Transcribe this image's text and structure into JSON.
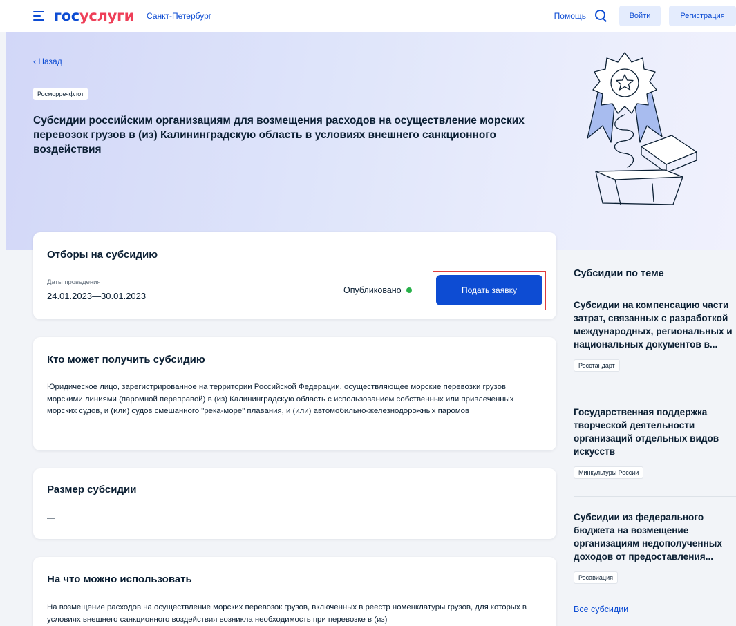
{
  "header": {
    "logo_gos": "гос",
    "logo_uslugi": "услуги",
    "region": "Санкт-Петербург",
    "help": "Помощь",
    "login": "Войти",
    "register": "Регистрация"
  },
  "hero": {
    "back": "‹ Назад",
    "agency": "Росморречфлот",
    "title": "Субсидии российским организациям для возмещения расходов на осуществление морских перевозок грузов в (из) Калининградскую область в условиях внешнего санкционного воздействия"
  },
  "selection": {
    "title": "Отборы на субсидию",
    "dates_label": "Даты проведения",
    "dates_value": "24.01.2023—30.01.2023",
    "status": "Опубликовано",
    "status_color": "#28b14a",
    "apply": "Подать заявку"
  },
  "who": {
    "title": "Кто может получить субсидию",
    "text": "Юридическое лицо, зарегистрированное на территории Российской Федерации, осуществляющее морские перевозки грузов морскими линиями (паромной переправой) в (из) Калининградскую область с использованием собственных или привлеченных морских судов, и (или) судов смешанного \"река-море\" плавания, и (или) автомобильно-железнодорожных паромов"
  },
  "size": {
    "title": "Размер субсидии",
    "value": "—"
  },
  "usage": {
    "title": "На что можно использовать",
    "text": "На возмещение расходов на осуществление морских перевозок грузов, включенных в реестр номенклатуры грузов, для которых в условиях внешнего санкционного воздействия возникла необходимость при перевозке в (из)"
  },
  "sidebar": {
    "title": "Субсидии по теме",
    "items": [
      {
        "title": "Субсидии на компенсацию части затрат, связанных с разработкой международных, региональных и национальных документов в...",
        "tag": "Росстандарт"
      },
      {
        "title": "Государственная поддержка творческой деятельности организаций отдельных видов искусств",
        "tag": "Минкультуры России"
      },
      {
        "title": "Субсидии из федерального бюджета на возмещение организациям недополученных доходов от предоставления...",
        "tag": "Росавиация"
      }
    ],
    "all_link": "Все субсидии"
  },
  "colors": {
    "accent": "#0d4cd3",
    "brand_red": "#ee3f58",
    "text": "#0b1f33"
  }
}
